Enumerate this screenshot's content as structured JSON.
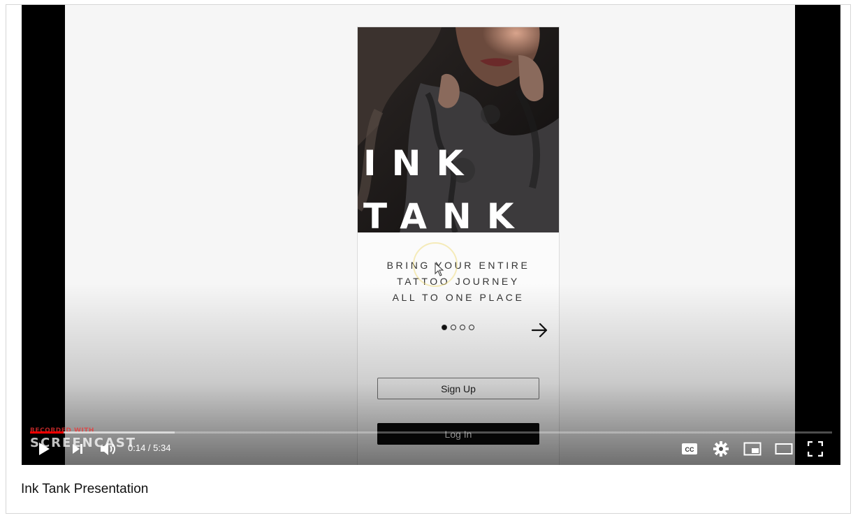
{
  "video": {
    "title": "Ink Tank Presentation",
    "time": "0:14 / 5:34",
    "progress_fraction": 0.042,
    "buffered_fraction": 0.18,
    "watermark_small": "RECORDED WITH",
    "watermark_big": "SCREENCAST",
    "controls": {
      "play_icon": "play-icon",
      "next_icon": "next-icon",
      "volume_icon": "volume-icon",
      "captions_icon": "cc-icon",
      "settings_icon": "gear-icon",
      "miniplayer_icon": "miniplayer-icon",
      "theater_icon": "theater-icon",
      "fullscreen_icon": "fullscreen-icon"
    }
  },
  "app": {
    "brand_line1": "INK",
    "brand_line2": "TANK",
    "tagline": [
      "BRING YOUR ENTIRE",
      "TATTOO JOURNEY",
      "ALL TO ONE PLACE"
    ],
    "carousel": {
      "count": 4,
      "active": 1
    },
    "signup_label": "Sign Up",
    "login_label": "Log In"
  },
  "colors": {
    "accent": "#ff0000",
    "login_bg": "#0b0b0b"
  }
}
